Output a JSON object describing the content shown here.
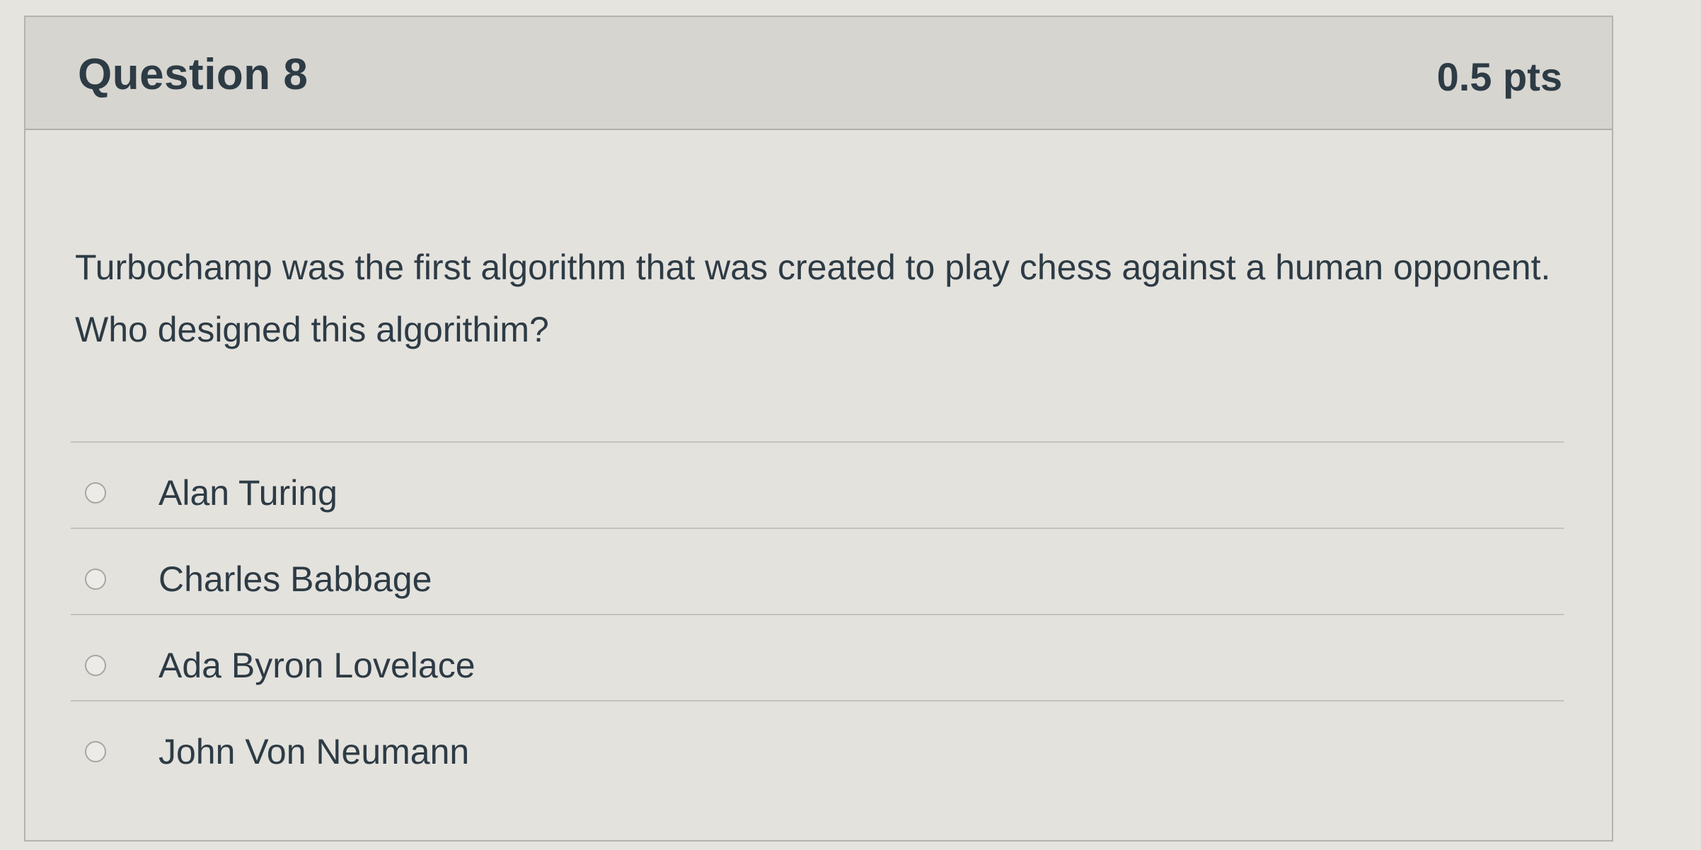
{
  "question": {
    "title": "Question 8",
    "points": "0.5 pts",
    "text": "Turbochamp was the first algorithm that was created to play chess against a human opponent.  Who designed this algorithim?",
    "answers": [
      {
        "label": "Alan Turing",
        "selected": false
      },
      {
        "label": "Charles Babbage",
        "selected": false
      },
      {
        "label": "Ada Byron Lovelace",
        "selected": false
      },
      {
        "label": "John Von Neumann",
        "selected": false
      }
    ]
  },
  "colors": {
    "text": "#2d3b45",
    "header_bg": "#d7d5d0",
    "card_bg": "#e4e2dd"
  }
}
